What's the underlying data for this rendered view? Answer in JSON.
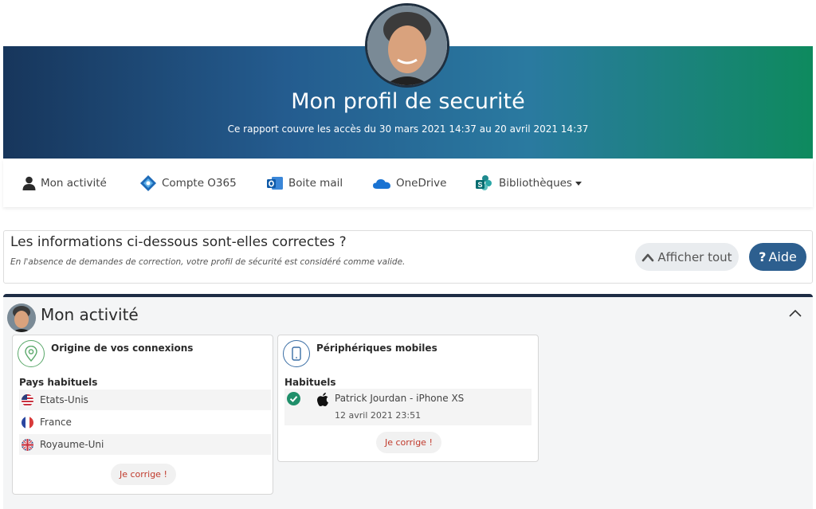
{
  "header": {
    "title": "Mon profil de securité",
    "subtitle": "Ce rapport couvre les accès du 30 mars 2021 14:37 au 20 avril 2021 14:37"
  },
  "nav": {
    "items": [
      {
        "label": "Mon activité",
        "icon": "user-icon"
      },
      {
        "label": "Compte O365",
        "icon": "azure-ad-icon"
      },
      {
        "label": "Boite mail",
        "icon": "outlook-icon"
      },
      {
        "label": "OneDrive",
        "icon": "onedrive-icon"
      },
      {
        "label": "Bibliothèques",
        "icon": "sharepoint-icon",
        "dropdown": true
      }
    ]
  },
  "question": {
    "title": "Les informations ci-dessous sont-elles correctes ?",
    "subtitle": "En l'absence de demandes de correction, votre profil de sécurité est considéré comme valide.",
    "show_all_label": "Afficher tout",
    "help_label": "Aide"
  },
  "activity": {
    "title": "Mon activité",
    "connections_card": {
      "title": "Origine de vos connexions",
      "subtitle": "Pays habituels",
      "countries": [
        "Etats-Unis",
        "France",
        "Royaume-Uni"
      ],
      "fix_label": "Je corrige !"
    },
    "mobile_card": {
      "title": "Périphériques mobiles",
      "subtitle": "Habituels",
      "device_name": "Patrick Jourdan - iPhone XS",
      "device_date": "12 avril 2021 23:51",
      "fix_label": "Je corrige !"
    }
  },
  "colors": {
    "banner_start": "#17365c",
    "banner_end": "#0e8a5e",
    "help_button": "#2d5f8f",
    "fix_text": "#c0392b",
    "check_green": "#1f8f6a"
  }
}
